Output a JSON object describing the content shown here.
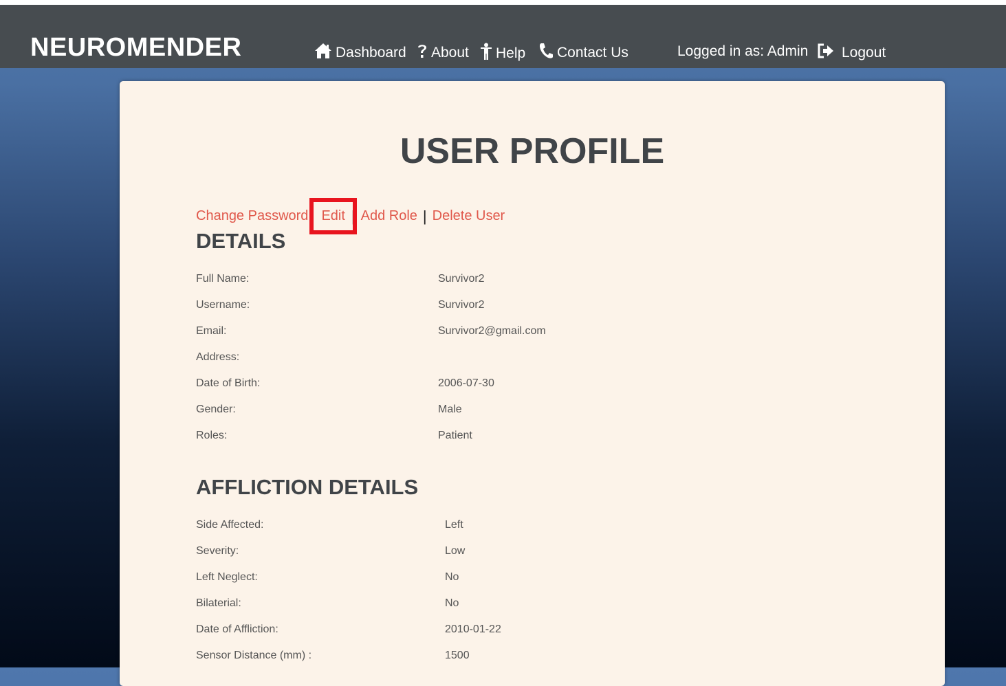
{
  "nav": {
    "brand": "NEUROMENDER",
    "links": [
      {
        "label": "Dashboard",
        "icon": "home-icon"
      },
      {
        "label": "About",
        "icon": "question-icon"
      },
      {
        "label": "Help",
        "icon": "person-icon"
      },
      {
        "label": "Contact Us",
        "icon": "phone-icon"
      }
    ],
    "logged_in": "Logged in as: Admin",
    "logout": "Logout"
  },
  "page": {
    "title": "USER PROFILE",
    "actions": {
      "change_password": "Change Password",
      "edit": "Edit",
      "add_role": "Add Role",
      "delete_user": "Delete User",
      "separator": "|"
    }
  },
  "details": {
    "heading": "DETAILS",
    "rows": [
      {
        "label": "Full Name:",
        "value": "Survivor2"
      },
      {
        "label": "Username:",
        "value": "Survivor2"
      },
      {
        "label": "Email:",
        "value": "Survivor2@gmail.com"
      },
      {
        "label": "Address:",
        "value": ""
      },
      {
        "label": "Date of Birth:",
        "value": "2006-07-30"
      },
      {
        "label": "Gender:",
        "value": "Male"
      },
      {
        "label": "Roles:",
        "value": "Patient"
      }
    ]
  },
  "affliction": {
    "heading": "AFFLICTION DETAILS",
    "rows": [
      {
        "label": "Side Affected:",
        "value": "Left"
      },
      {
        "label": "Severity:",
        "value": "Low"
      },
      {
        "label": "Left Neglect:",
        "value": "No"
      },
      {
        "label": "Bilaterial:",
        "value": "No"
      },
      {
        "label": "Date of Affliction:",
        "value": "2010-01-22"
      },
      {
        "label": "Sensor Distance (mm) :",
        "value": "1500"
      }
    ]
  },
  "colors": {
    "navbar": "#474c50",
    "card": "#fcf3e9",
    "link": "#e0584b",
    "highlight": "#e8141e",
    "heading": "#404448"
  }
}
